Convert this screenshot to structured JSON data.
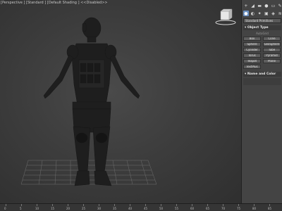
{
  "viewport": {
    "label": "[Perspective ] [Standard ] [Default Shading ] <<Disabled>>"
  },
  "command_panel": {
    "toolbar_icons": [
      "create-icon",
      "modify-icon",
      "hierarchy-icon",
      "motion-icon",
      "display-icon",
      "utilities-icon"
    ],
    "category_icons": [
      "geometry-icon",
      "shapes-icon",
      "lights-icon",
      "cameras-icon",
      "helpers-icon",
      "spacewarps-icon",
      "systems-icon"
    ],
    "dropdown": "Standard Primitives",
    "object_type": {
      "header": "Object Type",
      "autogrid": "AutoGrid",
      "buttons": [
        "Box",
        "Cone",
        "Sphere",
        "GeoSphere",
        "Cylinder",
        "Tube",
        "Torus",
        "Pyramid",
        "Teapot",
        "Plane",
        "TextPlus"
      ]
    },
    "name_and_color": {
      "header": "Name and Color"
    }
  },
  "timeline": {
    "ticks": [
      "0",
      "5",
      "10",
      "15",
      "20",
      "25",
      "30",
      "35",
      "40",
      "45",
      "50",
      "55",
      "60",
      "65",
      "70",
      "75",
      "80",
      "85"
    ]
  },
  "colors": {
    "active_tab": "#6a8fc0",
    "viewport_bg": "#3d3d3d",
    "figure": "#1f1f1f"
  }
}
